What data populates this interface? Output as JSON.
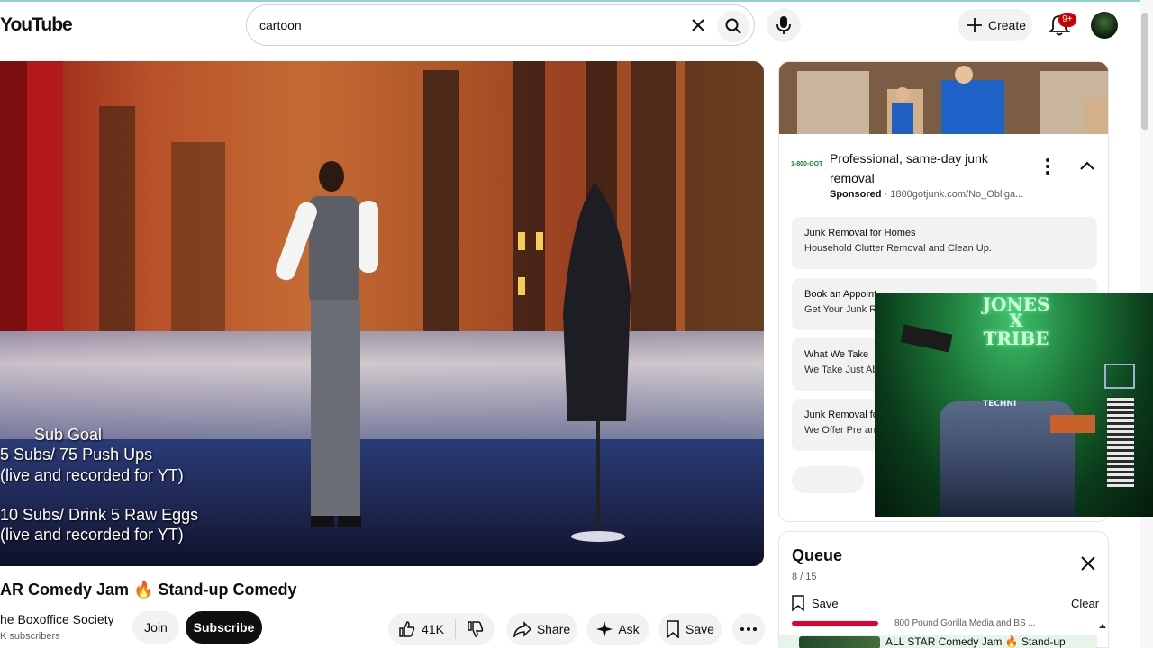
{
  "header": {
    "logo_text": "YouTube",
    "search": {
      "value": "cartoon"
    },
    "create_label": "Create",
    "notification_count": "9+"
  },
  "video": {
    "overlay": {
      "line1": "Sub Goal",
      "line2": "5 Subs/ 75 Push Ups",
      "line3": "(live and recorded for YT)",
      "line4": "10 Subs/ Drink 5 Raw Eggs",
      "line5": "(live and recorded for YT)"
    },
    "title": "AR Comedy Jam 🔥 Stand-up Comedy",
    "channel": "he Boxoffice Society",
    "subscribers": "K subscribers",
    "join_label": "Join",
    "subscribe_label": "Subscribe",
    "like_count": "41K",
    "share_label": "Share",
    "ask_label": "Ask",
    "save_label": "Save"
  },
  "ad": {
    "title": "Professional, same-day junk removal",
    "sponsored_label": "Sponsored",
    "url": "1800gotjunk.com/No_Obliga...",
    "logo_text": "1-800-GOT-JUNK?",
    "links": [
      {
        "heading": "Junk Removal for Homes",
        "sub": "Household Clutter Removal and Clean Up."
      },
      {
        "heading": "Book an Appoint",
        "sub": "Get Your Junk Re"
      },
      {
        "heading": "What We Take",
        "sub": "We Take Just Ab"
      },
      {
        "heading": "Junk Removal fo",
        "sub": "We Offer Pre and"
      }
    ]
  },
  "pip": {
    "neon_line1": "JONES",
    "neon_line2": "X",
    "neon_line3": "TRIBE",
    "chair_text": "TECHNI"
  },
  "queue": {
    "title": "Queue",
    "count": "8 / 15",
    "save_label": "Save",
    "clear_label": "Clear",
    "item1_channel": "800 Pound Gorilla Media and BS ...",
    "item2_title": "ALL STAR Comedy Jam 🔥 Stand-up"
  },
  "colors": {
    "subscribe_bg": "#0f0f0f",
    "badge": "#cc0000",
    "queue_active": "#e6f4ea"
  }
}
